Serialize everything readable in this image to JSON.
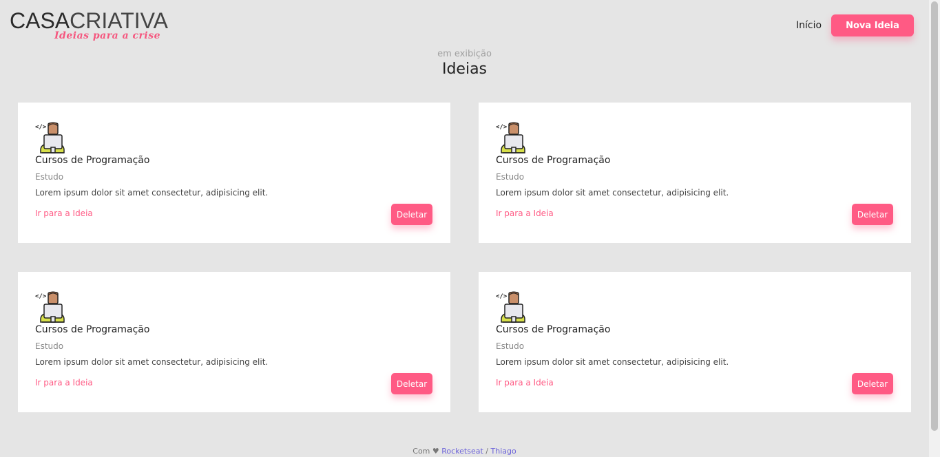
{
  "header": {
    "logo_main_bold": "CASA",
    "logo_main_light": "CRIATIVA",
    "logo_tagline": "Ideias para a crise",
    "nav_home": "Início",
    "new_idea_button": "Nova Ideia"
  },
  "section": {
    "subtitle": "em exibição",
    "title": "Ideias"
  },
  "cards": [
    {
      "icon": "programmer-icon",
      "title": "Cursos de Programação",
      "category": "Estudo",
      "description": "Lorem ipsum dolor sit amet consectetur, adipisicing elit.",
      "link": "Ir para a Ideia",
      "delete": "Deletar"
    },
    {
      "icon": "programmer-icon",
      "title": "Cursos de Programação",
      "category": "Estudo",
      "description": "Lorem ipsum dolor sit amet consectetur, adipisicing elit.",
      "link": "Ir para a Ideia",
      "delete": "Deletar"
    },
    {
      "icon": "programmer-icon",
      "title": "Cursos de Programação",
      "category": "Estudo",
      "description": "Lorem ipsum dolor sit amet consectetur, adipisicing elit.",
      "link": "Ir para a Ideia",
      "delete": "Deletar"
    },
    {
      "icon": "programmer-icon",
      "title": "Cursos de Programação",
      "category": "Estudo",
      "description": "Lorem ipsum dolor sit amet consectetur, adipisicing elit.",
      "link": "Ir para a Ideia",
      "delete": "Deletar"
    }
  ],
  "footer": {
    "prefix": "Com ♥",
    "link1": "Rocketseat",
    "separator": "/",
    "link2": "Thiago"
  },
  "colors": {
    "accent": "#ff5a84",
    "background": "#e5e5e5",
    "card": "#ffffff",
    "footer_link": "#6c63d9"
  }
}
